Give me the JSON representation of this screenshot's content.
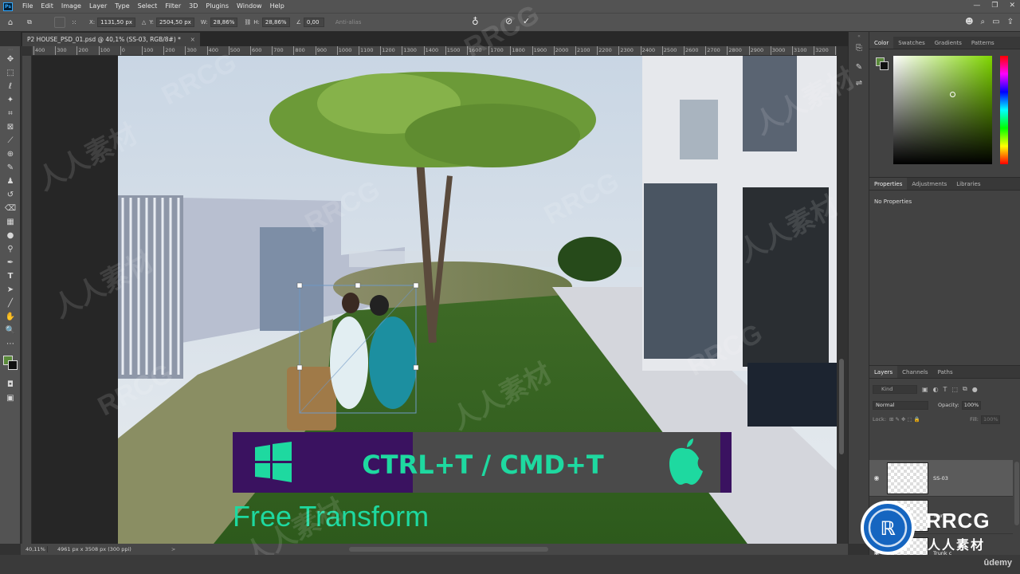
{
  "menubar": {
    "app_icon": "Ps",
    "items": [
      "File",
      "Edit",
      "Image",
      "Layer",
      "Type",
      "Select",
      "Filter",
      "3D",
      "Plugins",
      "Window",
      "Help"
    ],
    "window_controls": [
      "—",
      "❐",
      "✕"
    ]
  },
  "options": {
    "x_label": "X:",
    "x_value": "1131,50 px",
    "y_label": "Y:",
    "y_value": "2504,50 px",
    "w_label": "W:",
    "w_value": "28,86%",
    "h_label": "H:",
    "h_value": "28,86%",
    "angle_value": "0,00",
    "antialias": "Anti-alias",
    "cancel_icon": "⊘",
    "commit_icon": "✓"
  },
  "document": {
    "tab_title": "P2 HOUSE_PSD_01.psd @ 40,1% (SS-03, RGB/8#) *",
    "tab_close": "×",
    "ruler_labels": [
      "400",
      "300",
      "200",
      "100",
      "0",
      "100",
      "200",
      "300",
      "400",
      "500",
      "600",
      "700",
      "800",
      "900",
      "1000",
      "1100",
      "1200",
      "1300",
      "1400",
      "1500",
      "1600",
      "1700",
      "1800",
      "1900",
      "2000",
      "2100",
      "2200",
      "2300",
      "2400",
      "2500",
      "2600",
      "2700",
      "2800",
      "2900",
      "3000",
      "3100",
      "3200",
      "3300"
    ]
  },
  "overlay": {
    "shortcut": "CTRL+T / CMD+T",
    "caption": "Free Transform",
    "accent": "#1ed9a0",
    "purple": "#3a1260",
    "windows_icon": "windows-logo-icon",
    "apple_icon": "apple-logo-icon"
  },
  "status": {
    "zoom": "40,11%",
    "dimensions": "4961 px x 3508 px (300 ppi)",
    "arrow": ">"
  },
  "color_panel": {
    "tabs": [
      "Color",
      "Swatches",
      "Gradients",
      "Patterns"
    ]
  },
  "properties_panel": {
    "tabs": [
      "Properties",
      "Adjustments",
      "Libraries"
    ],
    "empty": "No Properties"
  },
  "layers_panel": {
    "tabs": [
      "Layers",
      "Channels",
      "Paths"
    ],
    "kind": "Kind",
    "blend_mode": "Normal",
    "opacity_label": "Opacity:",
    "opacity": "100%",
    "lock_label": "Lock:",
    "fill_label": "Fill:",
    "fill": "100%",
    "layers": [
      {
        "name": "SS-03",
        "selected": true
      },
      {
        "name": "Trunk",
        "selected": false
      },
      {
        "name": "Trunk c",
        "selected": false
      }
    ]
  },
  "watermark": {
    "logo_text": "RRCG",
    "logo_sub": "人人素材",
    "marks": [
      "RRCG",
      "人人素材",
      "RRCG",
      "人人素材",
      "RRCG",
      "人人素材",
      "RRCG",
      "人人素材",
      "RRCG",
      "人人素材",
      "RRCG",
      "人人素材"
    ]
  },
  "brand": {
    "udemy": "ûdemy"
  }
}
